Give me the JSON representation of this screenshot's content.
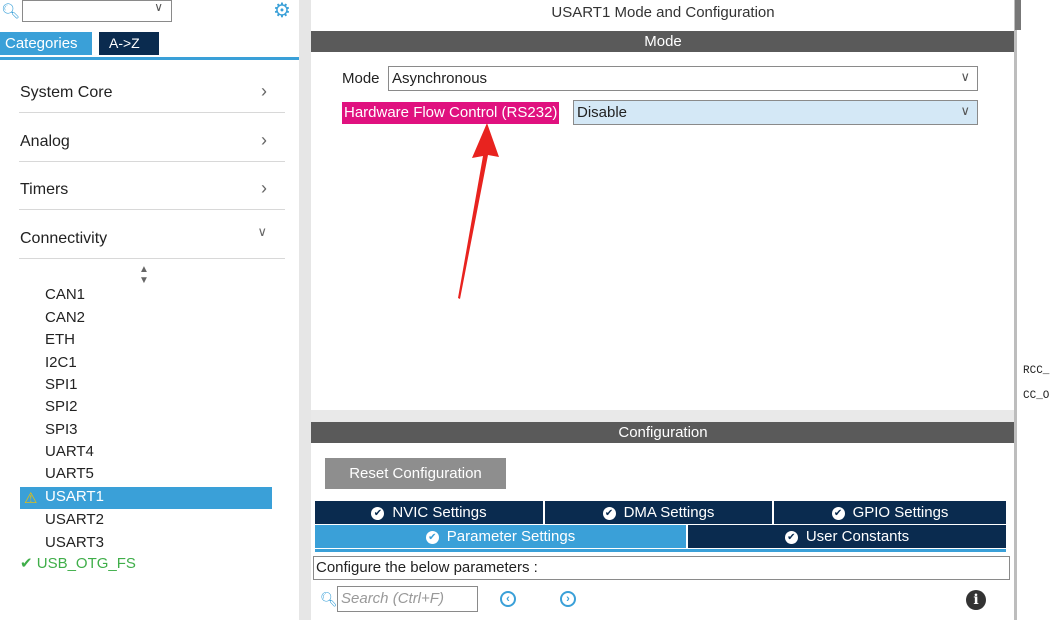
{
  "left": {
    "search_value": "",
    "tabs": {
      "categories": "Categories",
      "az": "A->Z"
    },
    "categories": [
      {
        "label": "System Core",
        "arrow": ">"
      },
      {
        "label": "Analog",
        "arrow": ">"
      },
      {
        "label": "Timers",
        "arrow": ">"
      },
      {
        "label": "Connectivity",
        "arrow": "v"
      }
    ],
    "peripherals": [
      "CAN1",
      "CAN2",
      "ETH",
      "I2C1",
      "SPI1",
      "SPI2",
      "SPI3",
      "UART4",
      "UART5"
    ],
    "selected_peripheral": "USART1",
    "peripherals_after": [
      "USART2",
      "USART3"
    ],
    "usb_otg": "USB_OTG_FS"
  },
  "main": {
    "title": "USART1 Mode and Configuration",
    "mode_bar": "Mode",
    "mode_label": "Mode",
    "mode_value": "Asynchronous",
    "hw_flow_label": "Hardware Flow Control (RS232)",
    "hw_flow_value": "Disable",
    "config_bar": "Configuration",
    "reset_button": "Reset Configuration",
    "tabs_row1": [
      "NVIC Settings",
      "DMA Settings",
      "GPIO Settings"
    ],
    "tabs_row2": [
      "Parameter Settings",
      "User Constants"
    ],
    "config_desc": "Configure the below parameters :",
    "search_placeholder": "Search (Ctrl+F)"
  },
  "right": {
    "rcc1": "RCC_",
    "rcc2": "CC_O"
  },
  "colors": {
    "accent": "#3aa0d8",
    "dark_tab": "#0a2b4f",
    "highlight": "#e0117f",
    "ok_green": "#3fae49",
    "warn": "#f2c200"
  }
}
